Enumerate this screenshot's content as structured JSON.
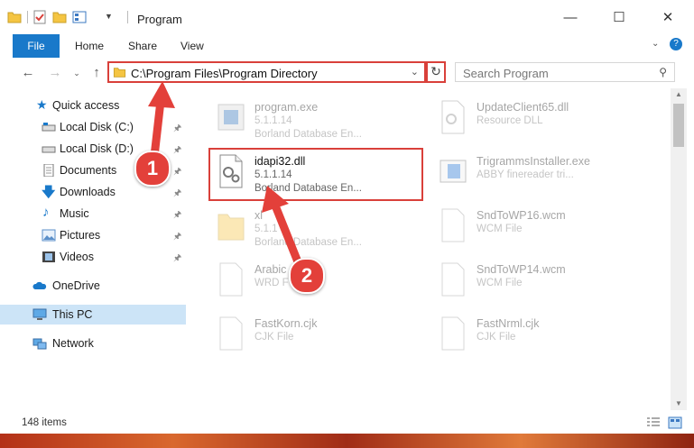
{
  "window": {
    "title": "Program"
  },
  "ribbon": {
    "file": "File",
    "tabs": [
      "Home",
      "Share",
      "View"
    ]
  },
  "address": {
    "path": "C:\\Program Files\\Program Directory"
  },
  "search": {
    "placeholder": "Search Program"
  },
  "sidebar": {
    "items": [
      {
        "label": "Quick access",
        "icon": "star-icon"
      },
      {
        "label": "Local Disk (C:)",
        "icon": "drive-icon"
      },
      {
        "label": "Local Disk (D:)",
        "icon": "drive-icon"
      },
      {
        "label": "Documents",
        "icon": "documents-icon"
      },
      {
        "label": "Downloads",
        "icon": "download-icon"
      },
      {
        "label": "Music",
        "icon": "music-icon"
      },
      {
        "label": "Pictures",
        "icon": "pictures-icon"
      },
      {
        "label": "Videos",
        "icon": "videos-icon"
      },
      {
        "label": "OneDrive",
        "icon": "cloud-icon"
      },
      {
        "label": "This PC",
        "icon": "monitor-icon"
      },
      {
        "label": "Network",
        "icon": "network-icon"
      }
    ]
  },
  "files": [
    {
      "name": "program.exe",
      "line1": "5.1.1.14",
      "line2": "Borland Database En..."
    },
    {
      "name": "UpdateClient65.dll",
      "line1": "Resource DLL",
      "line2": ""
    },
    {
      "name": "idapi32.dll",
      "line1": "5.1.1.14",
      "line2": "Borland Database En..."
    },
    {
      "name": "TrigrammsInstaller.exe",
      "line1": "ABBY finereader tri...",
      "line2": ""
    },
    {
      "name": "xl",
      "line1": "5.1.1",
      "line2": "Borland Database En..."
    },
    {
      "name": "SndToWP16.wcm",
      "line1": "WCM File",
      "line2": ""
    },
    {
      "name": "Arabic",
      "line1": "WRD F",
      "line2": ""
    },
    {
      "name": "SndToWP14.wcm",
      "line1": "WCM File",
      "line2": ""
    },
    {
      "name": "FastKorn.cjk",
      "line1": "CJK File",
      "line2": ""
    },
    {
      "name": "FastNrml.cjk",
      "line1": "CJK File",
      "line2": ""
    }
  ],
  "status": {
    "count": "148 items"
  },
  "callouts": {
    "one": "1",
    "two": "2"
  },
  "colors": {
    "accent": "#1979ca",
    "highlight": "#d9403a",
    "selected": "#cce4f7"
  }
}
